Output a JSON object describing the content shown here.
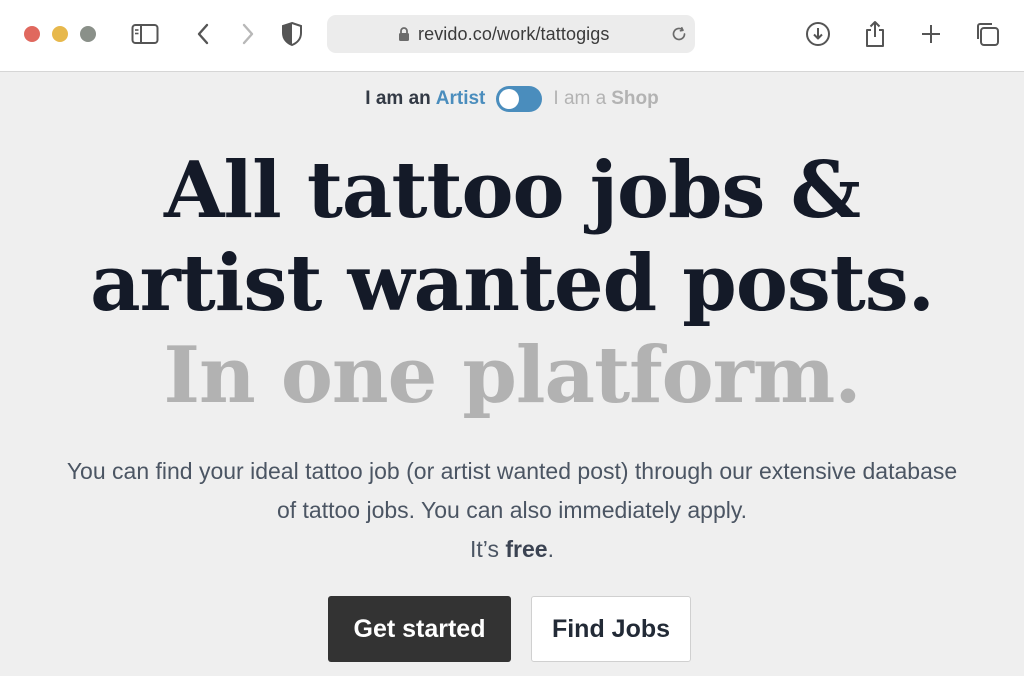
{
  "browser": {
    "url": "revido.co/work/tattogigs",
    "icons": [
      "sidebar-icon",
      "back-arrow-icon",
      "forward-arrow-icon",
      "privacy-shield-icon",
      "lock-icon",
      "reload-icon",
      "download-icon",
      "share-icon",
      "new-tab-plus-icon",
      "tab-overview-icon"
    ]
  },
  "role_switch": {
    "artist_prefix": "I am an",
    "artist_label": "Artist",
    "shop_prefix": "I am a",
    "shop_label": "Shop",
    "selected": "Artist",
    "accent_color": "#4a8dbd"
  },
  "hero": {
    "line1": "All tattoo jobs &",
    "line2": "artist wanted posts.",
    "line3": "In one platform."
  },
  "description": {
    "line1": "You can find your ideal tattoo job (or artist wanted post) through our extensive database",
    "line2": "of tattoo jobs. You can also immediately apply.",
    "line3_prefix": "It’s",
    "line3_bold": "free",
    "line3_suffix": "."
  },
  "buttons": {
    "primary": "Get started",
    "secondary": "Find Jobs"
  }
}
